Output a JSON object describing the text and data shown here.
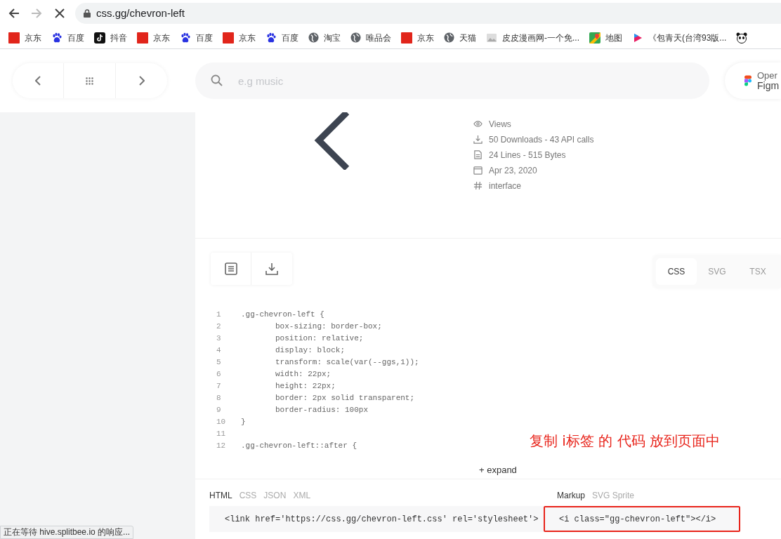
{
  "browser": {
    "back_disabled": false,
    "forward_disabled": true,
    "url": "css.gg/chevron-left"
  },
  "bookmarks": [
    {
      "kind": "jd",
      "label": "京东"
    },
    {
      "kind": "paw",
      "label": "百度"
    },
    {
      "kind": "note",
      "label": "抖音"
    },
    {
      "kind": "jd",
      "label": "京东"
    },
    {
      "kind": "paw",
      "label": "百度"
    },
    {
      "kind": "jd",
      "label": "京东"
    },
    {
      "kind": "paw",
      "label": "百度"
    },
    {
      "kind": "globe",
      "label": "淘宝"
    },
    {
      "kind": "globe",
      "label": "唯品会"
    },
    {
      "kind": "jd",
      "label": "京东"
    },
    {
      "kind": "globe",
      "label": "天猫"
    },
    {
      "kind": "image",
      "label": "皮皮漫画网-一个免..."
    },
    {
      "kind": "map",
      "label": "地图"
    },
    {
      "kind": "play",
      "label": "《包青天(台湾93版..."
    },
    {
      "kind": "panda"
    }
  ],
  "search": {
    "placeholder": "e.g music"
  },
  "figma_button": {
    "line_1": "Oper",
    "line_2": "Figm"
  },
  "meta": [
    {
      "kind": "eye",
      "text": "Views"
    },
    {
      "kind": "download",
      "text": "50 Downloads - 43 API calls"
    },
    {
      "kind": "file",
      "text": "24 Lines - 515 Bytes"
    },
    {
      "kind": "calendar",
      "text": "Apr 23, 2020"
    },
    {
      "kind": "hash",
      "text": "interface"
    }
  ],
  "code_tabs": [
    {
      "label": "CSS",
      "selected": true
    },
    {
      "label": "SVG",
      "selected": false
    },
    {
      "label": "TSX",
      "selected": false
    }
  ],
  "code_lines": [
    {
      "number": "1",
      "kind": "selector",
      "text": ".gg-chevron-left {"
    },
    {
      "number": "2",
      "kind": "property",
      "text": "box-sizing: border-box;"
    },
    {
      "number": "3",
      "kind": "property",
      "text": "position: relative;"
    },
    {
      "number": "4",
      "kind": "property",
      "text": "display: block;"
    },
    {
      "number": "5",
      "kind": "property",
      "text": "transform: scale(var(--ggs,1));"
    },
    {
      "number": "6",
      "kind": "property",
      "text": "width: 22px;"
    },
    {
      "number": "7",
      "kind": "property",
      "text": "height: 22px;"
    },
    {
      "number": "8",
      "kind": "property",
      "text": "border: 2px solid transparent;"
    },
    {
      "number": "9",
      "kind": "property",
      "text": "border-radius: 100px"
    },
    {
      "number": "10",
      "kind": "selector",
      "text": "}"
    },
    {
      "number": "11",
      "kind": "blank"
    },
    {
      "number": "12",
      "kind": "selector",
      "text": ".gg-chevron-left::after {"
    }
  ],
  "annotation": "复制 i标签 的 代码  放到页面中",
  "expand": "+ expand",
  "embed_tabs": [
    {
      "label": "HTML",
      "selected": true
    },
    {
      "label": "CSS",
      "selected": false
    },
    {
      "label": "JSON",
      "selected": false
    },
    {
      "label": "XML",
      "selected": false
    }
  ],
  "markup_tabs": [
    {
      "label": "Markup",
      "selected": true
    },
    {
      "label": "SVG Sprite",
      "selected": false
    }
  ],
  "embed_code": "<link href='https://css.gg/chevron-left.css' rel='stylesheet'>",
  "markup_code": "<i class=\"gg-chevron-left\"></i>",
  "markup_highlighted": true,
  "status": "正在等待 hive.splitbee.io 的响应..."
}
